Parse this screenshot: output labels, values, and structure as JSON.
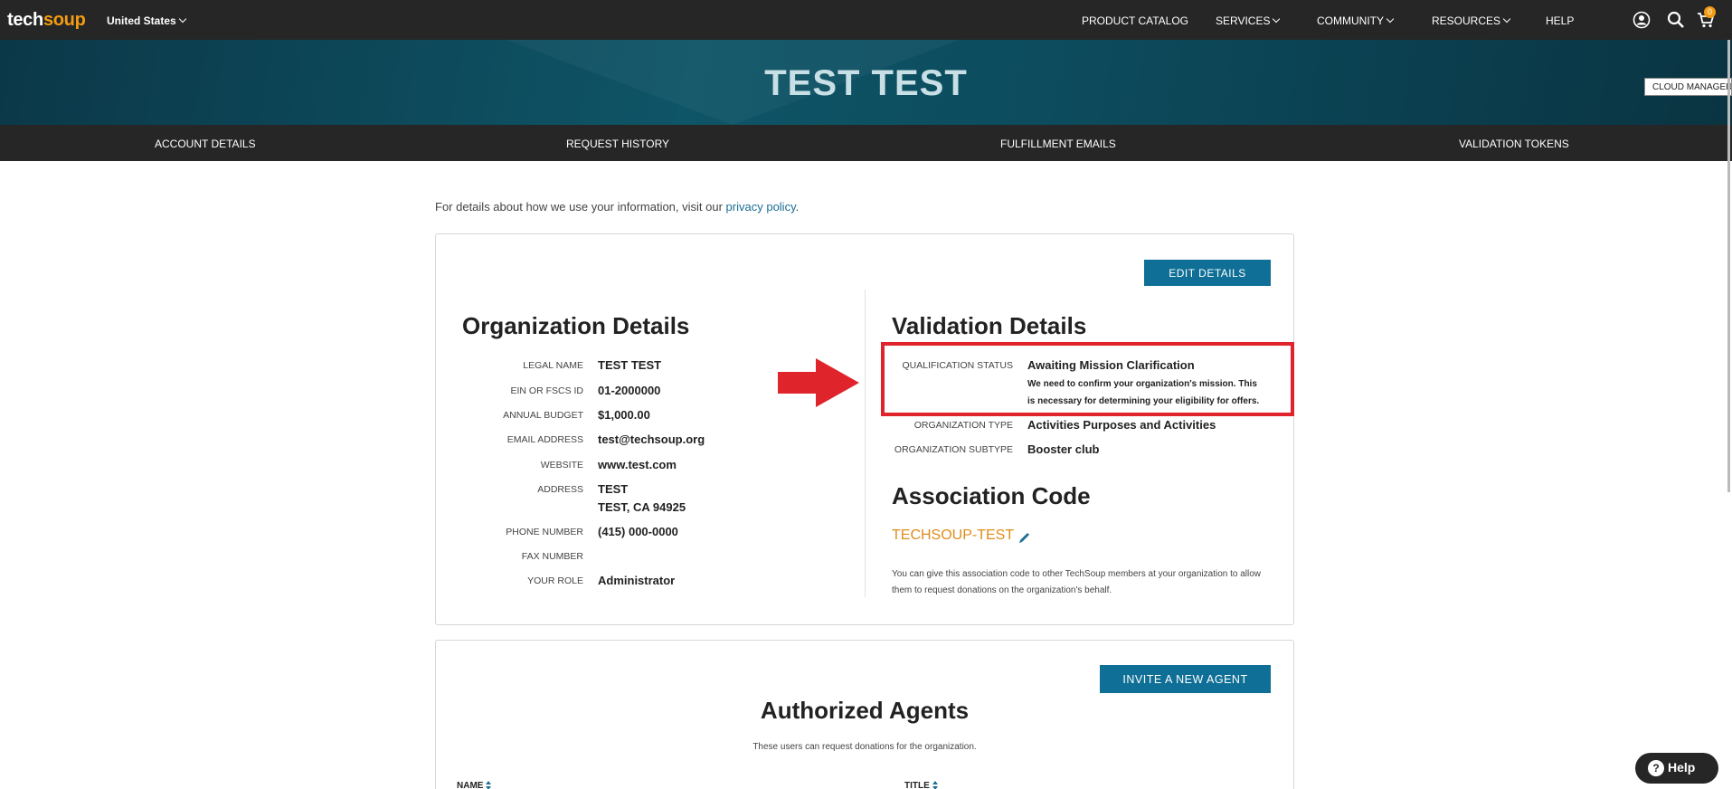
{
  "header": {
    "logo_tech": "tech",
    "logo_soup": "soup",
    "country": "United States",
    "nav": {
      "product_catalog": "PRODUCT CATALOG",
      "services": "SERVICES",
      "community": "COMMUNITY",
      "resources": "RESOURCES",
      "help": "HELP"
    },
    "cart_count": "0",
    "icons": [
      "account-icon",
      "search-icon",
      "cart-icon"
    ]
  },
  "hero": {
    "title": "TEST TEST",
    "cloud_manager": "CLOUD MANAGER"
  },
  "subnav": {
    "account_details": "ACCOUNT DETAILS",
    "request_history": "REQUEST HISTORY",
    "fulfillment_emails": "FULFILLMENT EMAILS",
    "validation_tokens": "VALIDATION TOKENS"
  },
  "privacy": {
    "text": "For details about how we use your information, visit our ",
    "link": "privacy policy",
    "end": "."
  },
  "org": {
    "edit_button": "EDIT DETAILS",
    "title": "Organization Details",
    "fields": {
      "legal_name": {
        "label": "LEGAL NAME",
        "value": "TEST TEST"
      },
      "ein": {
        "label": "EIN OR FSCS ID",
        "value": "01-2000000"
      },
      "budget": {
        "label": "ANNUAL BUDGET",
        "value": "$1,000.00"
      },
      "email": {
        "label": "EMAIL ADDRESS",
        "value": "test@techsoup.org"
      },
      "website": {
        "label": "WEBSITE",
        "value": "www.test.com"
      },
      "address": {
        "label": "ADDRESS",
        "line1": "TEST",
        "line2": "TEST, CA 94925"
      },
      "phone": {
        "label": "PHONE NUMBER",
        "value": "(415) 000-0000"
      },
      "fax": {
        "label": "FAX NUMBER",
        "value": ""
      },
      "role": {
        "label": "YOUR ROLE",
        "value": "Administrator"
      }
    }
  },
  "validation": {
    "title": "Validation Details",
    "qualification_label": "QUALIFICATION STATUS",
    "qualification_value": "Awaiting Mission Clarification",
    "qualification_note_1": "We need to confirm your organization's mission. This",
    "qualification_note_2": "is necessary for determining your eligibility for offers.",
    "org_type_label": "ORGANIZATION TYPE",
    "org_type_value": "Activities Purposes and Activities",
    "org_subtype_label": "ORGANIZATION SUBTYPE",
    "org_subtype_value": "Booster club",
    "highlight_color": "#e0242b"
  },
  "association": {
    "title": "Association Code",
    "code": "TECHSOUP-TEST",
    "note": "You can give this association code to other TechSoup members at your organization to allow them to request donations on the organization's behalf."
  },
  "agents": {
    "invite_button": "INVITE A NEW AGENT",
    "title": "Authorized Agents",
    "subtitle": "These users can request donations for the organization.",
    "col_name": "NAME",
    "col_title": "TITLE"
  },
  "help_widget": {
    "icon": "?",
    "label": "Help"
  },
  "colors": {
    "accent": "#0f6f96",
    "brand_orange": "#f39c12",
    "dark_bar": "#262626"
  }
}
